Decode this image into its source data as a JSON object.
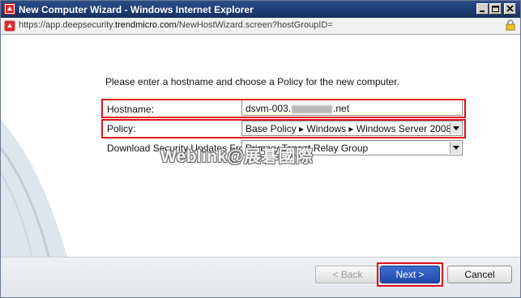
{
  "window": {
    "title": "New Computer Wizard - Windows Internet Explorer",
    "url_prefix": "https://app.deepsecurity.",
    "url_domain": "trendmicro.com",
    "url_suffix": "/NewHostWizard.screen?hostGroupID="
  },
  "form": {
    "intro": "Please enter a hostname and choose a Policy for the new computer.",
    "hostname_label": "Hostname:",
    "hostname_value_start": "dsvm-003.",
    "hostname_value_end": ".net",
    "policy_label": "Policy:",
    "policy_value": "Base Policy ▸ Windows ▸ Windows Server 2008",
    "relay_label": "Download Security Updates From:",
    "relay_value": "Primary Tenant Relay Group"
  },
  "watermark": "Weblink@展碁國際",
  "buttons": {
    "back": "< Back",
    "next": "Next >",
    "cancel": "Cancel"
  },
  "colors": {
    "highlight": "#e0101d",
    "title_bar": "#1d3c72",
    "primary_button": "#2a56b8"
  }
}
